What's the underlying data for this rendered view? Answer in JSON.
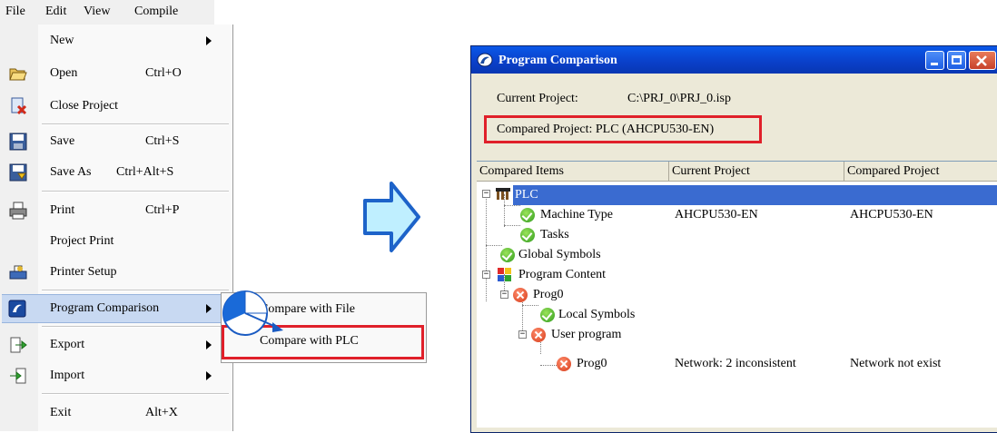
{
  "menubar": {
    "items": [
      {
        "label": "File",
        "key": "F"
      },
      {
        "label": "Edit",
        "key": "E"
      },
      {
        "label": "View",
        "key": "V"
      },
      {
        "label": "Compile",
        "key": "C"
      }
    ]
  },
  "file_menu": {
    "items": [
      {
        "label": "New",
        "shortcut": "",
        "icon": "none",
        "submenu": true
      },
      {
        "label": "Open",
        "shortcut": "Ctrl+O",
        "icon": "open-folder-icon"
      },
      {
        "label": "Close Project",
        "shortcut": "",
        "icon": "close-project-icon"
      },
      {
        "label": "Save",
        "shortcut": "Ctrl+S",
        "icon": "floppy-disk-icon"
      },
      {
        "label": "Save As",
        "shortcut": "Ctrl+Alt+S",
        "icon": "save-as-icon"
      },
      {
        "label": "Print",
        "shortcut": "Ctrl+P",
        "icon": "printer-icon"
      },
      {
        "label": "Project Print",
        "shortcut": "",
        "icon": "none"
      },
      {
        "label": "Printer Setup",
        "shortcut": "",
        "icon": "printer-setup-icon"
      },
      {
        "label": "Program Comparison",
        "shortcut": "",
        "icon": "program-comparison-icon",
        "submenu": true,
        "highlighted": true
      },
      {
        "label": "Export",
        "shortcut": "",
        "icon": "export-icon",
        "submenu": true
      },
      {
        "label": "Import",
        "shortcut": "",
        "icon": "import-icon",
        "submenu": true
      },
      {
        "label": "Exit",
        "shortcut": "Alt+X",
        "icon": "none"
      }
    ]
  },
  "submenu": {
    "items": [
      {
        "label": "Compare with File"
      },
      {
        "label": "Compare with PLC",
        "highlighted_box": true
      }
    ]
  },
  "dialog": {
    "title": "Program Comparison",
    "current_project_label": "Current Project:",
    "current_project_value": "C:\\PRJ_0\\PRJ_0.isp",
    "compared_project_label": "Compared Project:",
    "compared_project_value": "PLC (AHCPU530-EN)",
    "columns": [
      "Compared Items",
      "Current Project",
      "Compared Project"
    ],
    "rows": [
      {
        "name": "PLC",
        "status": "plc",
        "current": "",
        "compared": "",
        "selected": true
      },
      {
        "name": "Machine Type",
        "status": "ok",
        "current": "AHCPU530-EN",
        "compared": "AHCPU530-EN"
      },
      {
        "name": "Tasks",
        "status": "ok",
        "current": "",
        "compared": ""
      },
      {
        "name": "Global Symbols",
        "status": "ok",
        "current": "",
        "compared": ""
      },
      {
        "name": "Program Content",
        "status": "program",
        "current": "",
        "compared": ""
      },
      {
        "name": "Prog0",
        "status": "error",
        "current": "",
        "compared": ""
      },
      {
        "name": "Local Symbols",
        "status": "ok",
        "current": "",
        "compared": ""
      },
      {
        "name": "User program",
        "status": "error",
        "current": "",
        "compared": ""
      },
      {
        "name": "Prog0",
        "status": "error",
        "current": "Network: 2 inconsistent",
        "compared": "Network not exist"
      }
    ]
  },
  "colors": {
    "highlight_red": "#e0202a",
    "selection_blue": "#3a6bd0",
    "arrow_fill": "#bfefff",
    "arrow_stroke": "#1d63c9"
  }
}
